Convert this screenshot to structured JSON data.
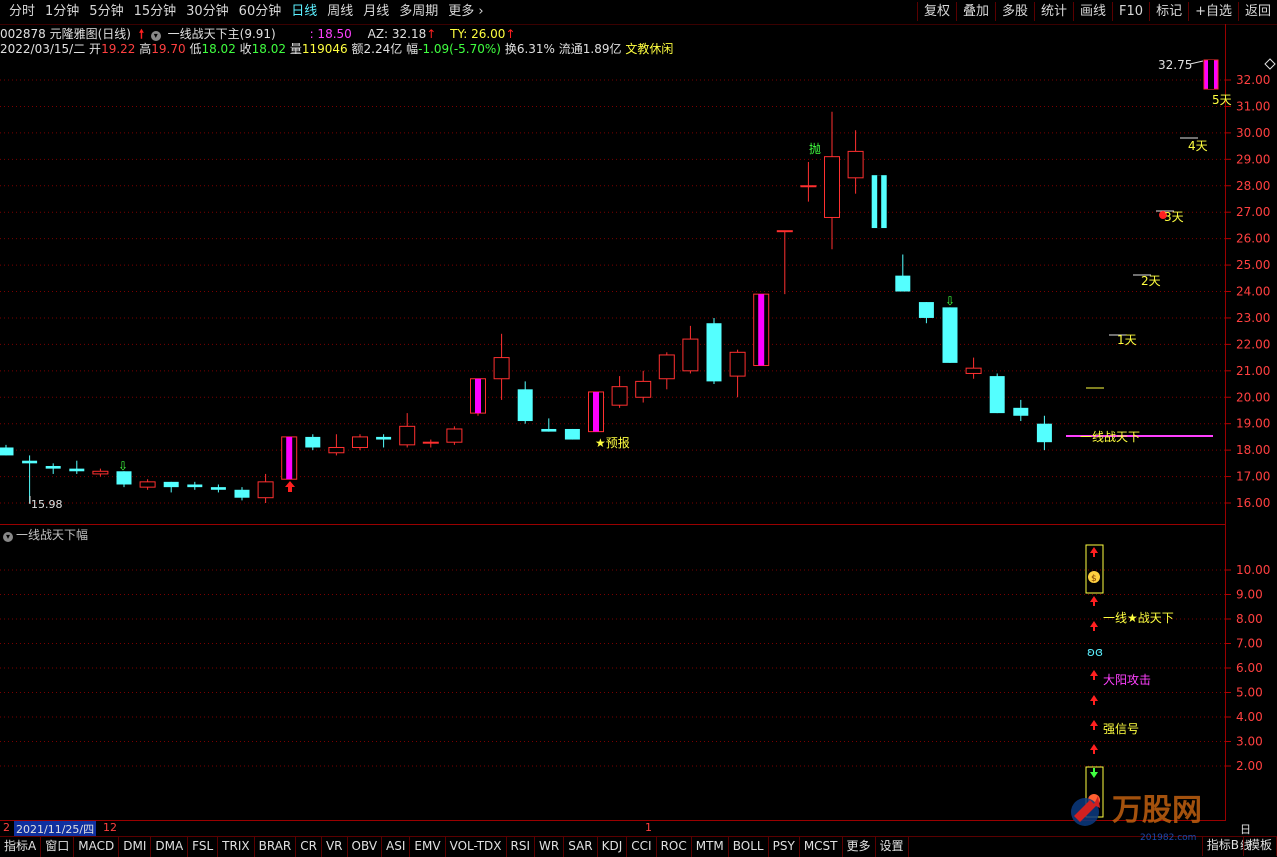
{
  "toolbar": {
    "periods": [
      "分时",
      "1分钟",
      "5分钟",
      "15分钟",
      "30分钟",
      "60分钟",
      "日线",
      "周线",
      "月线",
      "多周期",
      "更多 ›"
    ],
    "active_period": "日线",
    "right_buttons": [
      "复权",
      "叠加",
      "多股",
      "统计",
      "画线",
      "F10",
      "标记",
      "+自选",
      "返回"
    ]
  },
  "quote": {
    "code_name": "002878 元隆雅图(日线)",
    "indicator_name": "一线战天下主",
    "indicator_value": "(9.91)",
    "ind_line1": ": 18.50",
    "az": "AZ: 32.18",
    "ty": "TY: 26.00",
    "date": "2022/03/15/二",
    "open_label": "开",
    "open": "19.22",
    "high_label": "高",
    "high": "19.70",
    "low_label": "低",
    "low": "18.02",
    "close_label": "收",
    "close": "18.02",
    "vol_label": "量",
    "vol": "119046",
    "amt_label": "额",
    "amt": "2.24亿",
    "chg_label": "幅",
    "chg": "-1.09(-5.70%)",
    "turnover": "换6.31%",
    "float_cap": "流通1.89亿",
    "sector": "文教休闲"
  },
  "main_axis": [
    "32.00",
    "31.00",
    "30.00",
    "29.00",
    "28.00",
    "27.00",
    "26.00",
    "25.00",
    "24.00",
    "23.00",
    "22.00",
    "21.00",
    "20.00",
    "19.00",
    "18.00",
    "17.00",
    "16.00"
  ],
  "main_labels": {
    "low_mark": "15.98",
    "high_mark": "32.75",
    "forecast": "★预报",
    "pao": "抛",
    "line_label": "一线战天下",
    "days": [
      "1天",
      "2天",
      "3天",
      "4天",
      "5天"
    ]
  },
  "sub_indicator": {
    "title": "一线战天下幅",
    "axis": [
      "10.00",
      "9.00",
      "8.00",
      "7.00",
      "6.00",
      "5.00",
      "4.00",
      "3.00",
      "2.00"
    ],
    "labels": [
      "一线★战天下",
      "大阳攻击",
      "强信号"
    ]
  },
  "date_axis": {
    "left_edge": "2",
    "cursor_date": "2021/11/25/四",
    "month12": "12",
    "month1": "1",
    "period": "日线"
  },
  "tabs": [
    "指标A",
    "窗口",
    "MACD",
    "DMI",
    "DMA",
    "FSL",
    "TRIX",
    "BRAR",
    "CR",
    "VR",
    "OBV",
    "ASI",
    "EMV",
    "VOL-TDX",
    "RSI",
    "WR",
    "SAR",
    "KDJ",
    "CCI",
    "ROC",
    "MTM",
    "BOLL",
    "PSY",
    "MCST",
    "更多",
    "设置"
  ],
  "tabs_right": [
    "指标B",
    "模板"
  ],
  "logo": {
    "text": "万股网",
    "url_text": "201982.com"
  },
  "chart_data": {
    "type": "candlestick",
    "title": "002878 元隆雅图(日线)",
    "ylim": [
      15.5,
      33.2
    ],
    "candles": [
      {
        "o": 18.1,
        "h": 18.2,
        "l": 17.8,
        "c": 17.8
      },
      {
        "o": 17.6,
        "h": 17.8,
        "l": 15.98,
        "c": 17.5
      },
      {
        "o": 17.4,
        "h": 17.5,
        "l": 17.1,
        "c": 17.3
      },
      {
        "o": 17.3,
        "h": 17.6,
        "l": 17.1,
        "c": 17.2
      },
      {
        "o": 17.1,
        "h": 17.3,
        "l": 17.0,
        "c": 17.2
      },
      {
        "o": 17.2,
        "h": 17.2,
        "l": 16.6,
        "c": 16.7
      },
      {
        "o": 16.6,
        "h": 16.9,
        "l": 16.5,
        "c": 16.8
      },
      {
        "o": 16.8,
        "h": 16.8,
        "l": 16.4,
        "c": 16.6
      },
      {
        "o": 16.7,
        "h": 16.8,
        "l": 16.5,
        "c": 16.6
      },
      {
        "o": 16.6,
        "h": 16.7,
        "l": 16.4,
        "c": 16.5
      },
      {
        "o": 16.5,
        "h": 16.6,
        "l": 16.1,
        "c": 16.2
      },
      {
        "o": 16.2,
        "h": 17.1,
        "l": 16.0,
        "c": 16.8
      },
      {
        "o": 16.9,
        "h": 18.5,
        "l": 16.9,
        "c": 18.5
      },
      {
        "o": 18.5,
        "h": 18.6,
        "l": 18.0,
        "c": 18.1
      },
      {
        "o": 17.9,
        "h": 18.6,
        "l": 17.8,
        "c": 18.1
      },
      {
        "o": 18.1,
        "h": 18.6,
        "l": 18.0,
        "c": 18.5
      },
      {
        "o": 18.5,
        "h": 18.6,
        "l": 18.1,
        "c": 18.4
      },
      {
        "o": 18.2,
        "h": 19.4,
        "l": 18.1,
        "c": 18.9
      },
      {
        "o": 18.3,
        "h": 18.4,
        "l": 18.1,
        "c": 18.3
      },
      {
        "o": 18.3,
        "h": 18.9,
        "l": 18.2,
        "c": 18.8
      },
      {
        "o": 19.4,
        "h": 20.7,
        "l": 19.3,
        "c": 20.7
      },
      {
        "o": 20.7,
        "h": 22.4,
        "l": 19.9,
        "c": 21.5
      },
      {
        "o": 20.3,
        "h": 20.6,
        "l": 19.0,
        "c": 19.1
      },
      {
        "o": 18.8,
        "h": 19.2,
        "l": 18.7,
        "c": 18.7
      },
      {
        "o": 18.8,
        "h": 18.8,
        "l": 18.4,
        "c": 18.4
      },
      {
        "o": 18.7,
        "h": 20.2,
        "l": 18.7,
        "c": 20.2
      },
      {
        "o": 19.7,
        "h": 20.8,
        "l": 19.6,
        "c": 20.4
      },
      {
        "o": 20.0,
        "h": 21.0,
        "l": 19.8,
        "c": 20.6
      },
      {
        "o": 20.7,
        "h": 21.7,
        "l": 20.3,
        "c": 21.6
      },
      {
        "o": 21.0,
        "h": 22.7,
        "l": 20.9,
        "c": 22.2
      },
      {
        "o": 22.8,
        "h": 23.0,
        "l": 20.5,
        "c": 20.6
      },
      {
        "o": 20.8,
        "h": 21.8,
        "l": 20.0,
        "c": 21.7
      },
      {
        "o": 21.2,
        "h": 23.9,
        "l": 21.2,
        "c": 23.9
      },
      {
        "o": 26.3,
        "h": 26.3,
        "l": 23.9,
        "c": 26.3
      },
      {
        "o": 28.0,
        "h": 28.9,
        "l": 27.4,
        "c": 28.0
      },
      {
        "o": 26.8,
        "h": 30.8,
        "l": 25.6,
        "c": 29.1
      },
      {
        "o": 28.3,
        "h": 30.1,
        "l": 27.7,
        "c": 29.3
      },
      {
        "o": 28.4,
        "h": 28.4,
        "l": 26.4,
        "c": 26.4
      },
      {
        "o": 24.6,
        "h": 25.4,
        "l": 24.0,
        "c": 24.0
      },
      {
        "o": 23.6,
        "h": 23.6,
        "l": 22.8,
        "c": 23.0
      },
      {
        "o": 23.4,
        "h": 23.4,
        "l": 21.3,
        "c": 21.3
      },
      {
        "o": 20.9,
        "h": 21.5,
        "l": 20.7,
        "c": 21.1
      },
      {
        "o": 20.8,
        "h": 20.9,
        "l": 19.4,
        "c": 19.4
      },
      {
        "o": 19.6,
        "h": 19.9,
        "l": 19.1,
        "c": 19.3
      },
      {
        "o": 19.0,
        "h": 19.3,
        "l": 18.0,
        "c": 18.3
      }
    ]
  }
}
